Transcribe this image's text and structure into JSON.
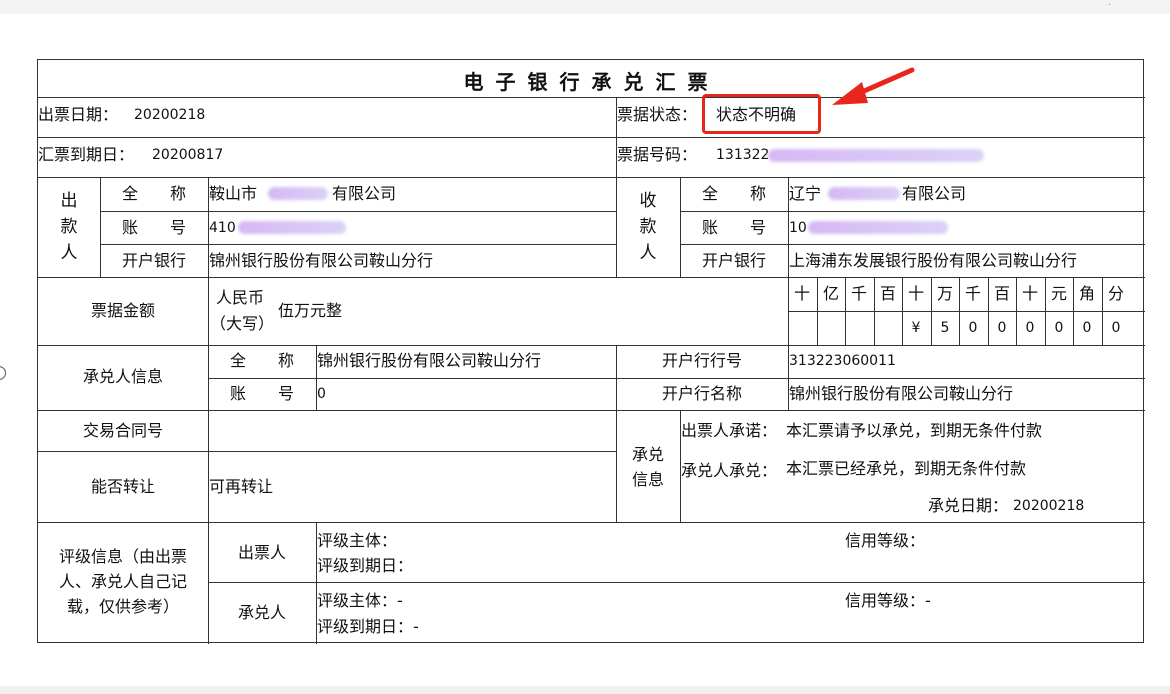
{
  "title": "电子银行承兑汇票",
  "header": {
    "issue_date_label": "出票日期：",
    "issue_date": "20200218",
    "due_date_label": "汇票到期日：",
    "due_date": "20200817",
    "status_label": "票据状态：",
    "status": "状态不明确",
    "bill_no_label": "票据号码：",
    "bill_no": "131322"
  },
  "drawer": {
    "side_label": [
      "出",
      "款",
      "人"
    ],
    "name_label": "全　　称",
    "name_prefix": "鞍山市",
    "name_suffix": "有限公司",
    "account_label": "账　　号",
    "account_prefix": "410",
    "bank_label": "开户银行",
    "bank": "锦州银行股份有限公司鞍山分行"
  },
  "payee": {
    "side_label": [
      "收",
      "款",
      "人"
    ],
    "name_label": "全　　称",
    "name_prefix": "辽宁",
    "name_suffix": "有限公司",
    "account_label": "账　　号",
    "account_prefix": "10",
    "bank_label": "开户银行",
    "bank": "上海浦东发展银行股份有限公司鞍山分行"
  },
  "amount": {
    "label": "票据金额",
    "currency_line1": "人民币",
    "currency_line2": "（大写）",
    "words": "伍万元整",
    "digit_headers": [
      "十",
      "亿",
      "千",
      "百",
      "十",
      "万",
      "千",
      "百",
      "十",
      "元",
      "角",
      "分"
    ],
    "digits": [
      "",
      "",
      "",
      "",
      "¥",
      "5",
      "0",
      "0",
      "0",
      "0",
      "0",
      "0"
    ]
  },
  "acceptor": {
    "label": "承兑人信息",
    "name_label": "全　　称",
    "name": "锦州银行股份有限公司鞍山分行",
    "account_label": "账　　号",
    "account": "0",
    "bank_no_label": "开户行行号",
    "bank_no": "313223060011",
    "bank_name_label": "开户行名称",
    "bank_name": "锦州银行股份有限公司鞍山分行"
  },
  "contract": {
    "label": "交易合同号",
    "value": ""
  },
  "transfer": {
    "label": "能否转让",
    "value": "可再转让"
  },
  "acceptance": {
    "label_line1": "承兑",
    "label_line2": "信息",
    "drawer_promise_label": "出票人承诺：",
    "drawer_promise": "本汇票请予以承兑，到期无条件付款",
    "acceptor_promise_label": "承兑人承兑：",
    "acceptor_promise": "本汇票已经承兑，到期无条件付款",
    "accept_date_label": "承兑日期：",
    "accept_date": "20200218"
  },
  "rating": {
    "label_line1": "评级信息（由出票",
    "label_line2": "人、承兑人自己记",
    "label_line3": "载，仅供参考）",
    "drawer_label": "出票人",
    "acceptor_label": "承兑人",
    "entity_label": "评级主体：",
    "expiry_label": "评级到期日：",
    "grade_label": "信用等级：",
    "acceptor_entity": "评级主体：-",
    "acceptor_expiry": "评级到期日：-",
    "acceptor_grade": "信用等级：-"
  },
  "colors": {
    "highlight": "#e8261c",
    "redaction": "#c8a0f0"
  }
}
